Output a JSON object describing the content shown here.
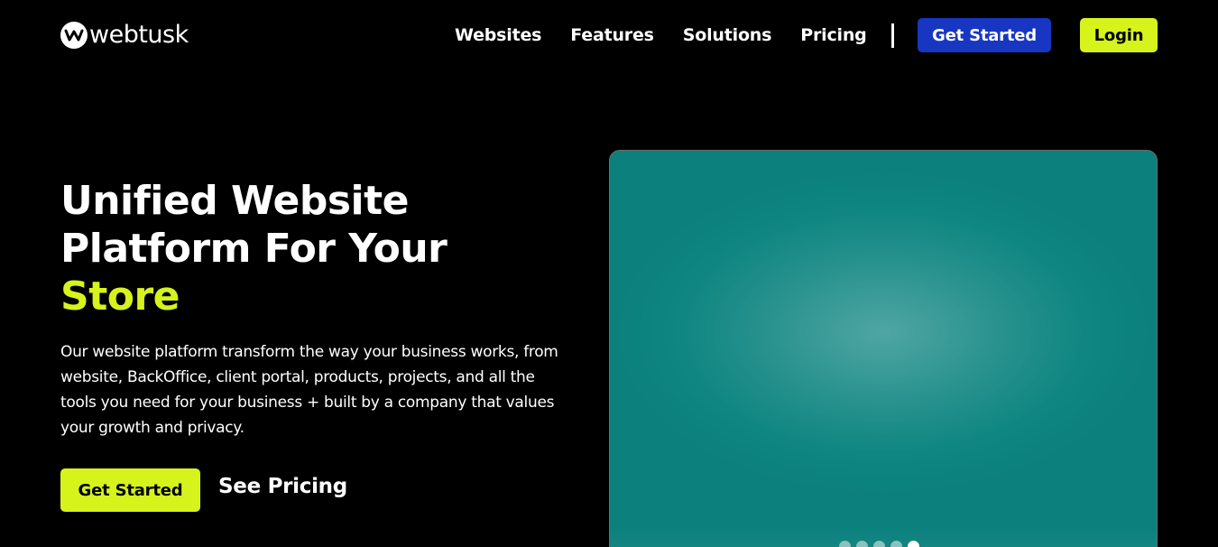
{
  "header": {
    "logo_text": "webtusk",
    "logo_icon": "webtusk-logo-mark",
    "nav": [
      {
        "label": "Websites"
      },
      {
        "label": "Features"
      },
      {
        "label": "Solutions"
      },
      {
        "label": "Pricing"
      }
    ],
    "cta_primary": "Get Started",
    "cta_login": "Login"
  },
  "hero": {
    "title_line1": "Unified Website",
    "title_line2": "Platform For Your",
    "title_accent": "Store",
    "description": "Our website platform transform the way your business works, from website, BackOffice, client portal, products, projects, and all the tools you need for your business + built by a company that values your growth and privacy.",
    "primary_button": "Get Started",
    "secondary_link": "See Pricing",
    "carousel_slides": 5,
    "carousel_active": 5
  },
  "colors": {
    "background": "#000000",
    "accent": "#d7f31c",
    "primary_blue": "#1736c1",
    "media_teal": "#0f8682"
  }
}
